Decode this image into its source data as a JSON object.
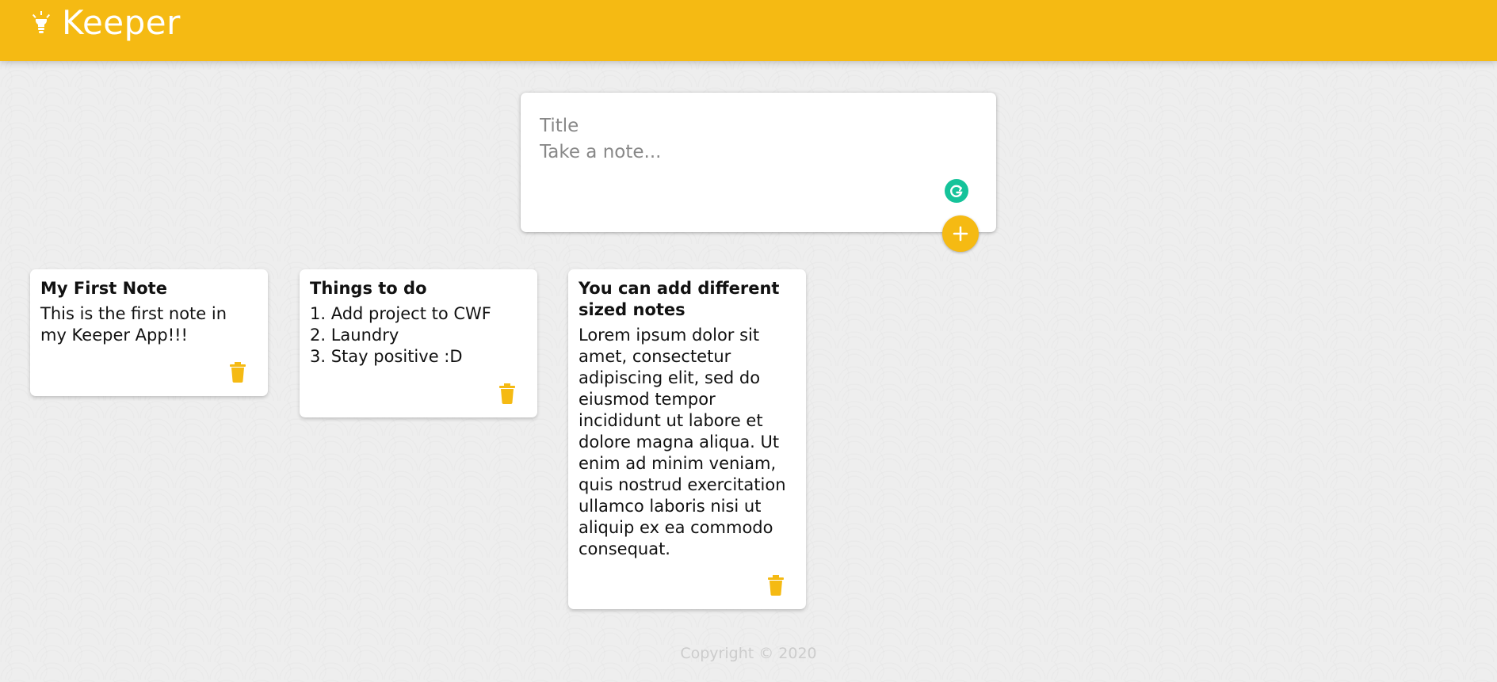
{
  "app": {
    "title": "Keeper",
    "icon": "lightbulb-icon",
    "brand_color": "#f5ba13"
  },
  "create_note": {
    "title_placeholder": "Title",
    "content_placeholder": "Take a note...",
    "add_icon": "plus-icon",
    "grammarly_icon": "grammarly-icon"
  },
  "notes": [
    {
      "title": "My First Note",
      "content": "This is the first note in my Keeper App!!!"
    },
    {
      "title": "Things to do",
      "content": "1. Add project to CWF\n2. Laundry\n3. Stay positive :D"
    },
    {
      "title": "You can add different sized notes",
      "content": "Lorem ipsum dolor sit amet, consectetur adipiscing elit, sed do eiusmod tempor incididunt ut labore et dolore magna aliqua. Ut enim ad minim veniam, quis nostrud exercitation ullamco laboris nisi ut aliquip ex ea commodo consequat."
    }
  ],
  "delete_icon": "trash-icon",
  "footer": {
    "copyright": "Copyright © 2020"
  }
}
